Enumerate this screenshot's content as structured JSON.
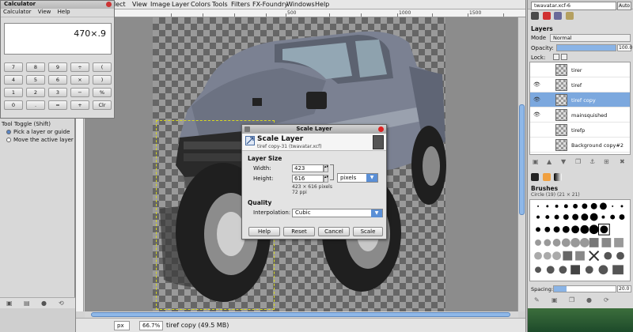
{
  "image_window": {
    "menu": [
      "lect",
      "View",
      "Image",
      "Layer",
      "Colors",
      "Tools",
      "Filters",
      "FX-Foundry",
      "Windows",
      "Help"
    ],
    "ruler_labels": [
      "500",
      "1000",
      "1500"
    ],
    "status": {
      "unit": "px",
      "zoom": "66.7%",
      "text": "tiref copy (49.5 MB)"
    }
  },
  "calculator": {
    "title": "Calculator",
    "menu": [
      "Calculator",
      "View",
      "Help"
    ],
    "display": "470×.9",
    "keys": [
      "7",
      "8",
      "9",
      "÷",
      "(",
      "4",
      "5",
      "6",
      "×",
      ")",
      "1",
      "2",
      "3",
      "−",
      "%",
      "0",
      ".",
      "=",
      "+",
      "Clr"
    ]
  },
  "toolbox": {
    "title": "Tool Toggle  (Shift)",
    "options": [
      "Pick a layer or guide",
      "Move the active layer"
    ]
  },
  "scale_dialog": {
    "title": "Scale Layer",
    "heading": "Scale Layer",
    "subheading": "tiref copy-31 (twavatar.xcf)",
    "layer_size_label": "Layer Size",
    "width_label": "Width:",
    "width_value": "423",
    "height_label": "Height:",
    "height_value": "616",
    "unit": "pixels",
    "size_info": "423 × 616 pixels",
    "ppi_info": "72 ppi",
    "quality_label": "Quality",
    "interpolation_label": "Interpolation:",
    "interpolation_value": "Cubic",
    "buttons": {
      "help": "Help",
      "reset": "Reset",
      "cancel": "Cancel",
      "scale": "Scale"
    }
  },
  "dock": {
    "image_selector": "twavatar.xcf-6",
    "auto_label": "Auto",
    "layers_title": "Layers",
    "mode_label": "Mode",
    "mode_value": "Normal",
    "opacity_label": "Opacity:",
    "opacity_value": "100.0",
    "opacity_fraction": 1.0,
    "lock_label": "Lock:",
    "layers": [
      {
        "name": "tirer",
        "visible": false,
        "selected": false
      },
      {
        "name": "tiref",
        "visible": true,
        "selected": false
      },
      {
        "name": "tiref copy",
        "visible": true,
        "selected": true
      },
      {
        "name": "mainsquished",
        "visible": true,
        "selected": false
      },
      {
        "name": "tirefp",
        "visible": false,
        "selected": false
      },
      {
        "name": "Background copy#2",
        "visible": false,
        "selected": false
      }
    ],
    "brushes_title": "Brushes",
    "brush_name": "Circle (19) (21 × 21)",
    "spacing_label": "Spacing:",
    "spacing_value": "20.0",
    "spacing_fraction": 0.2
  }
}
